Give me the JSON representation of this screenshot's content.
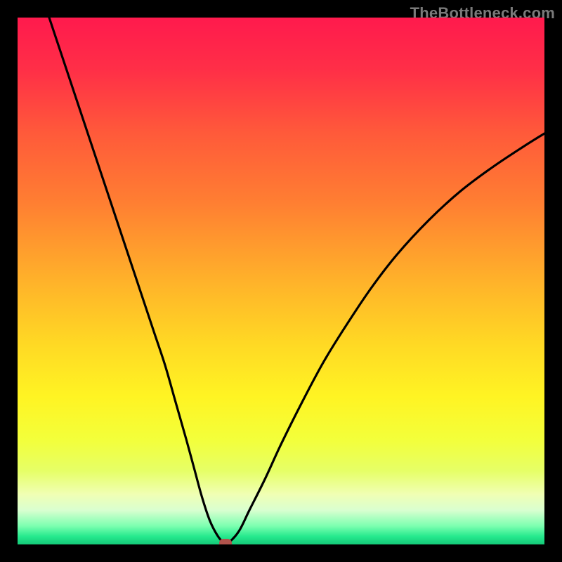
{
  "watermark": "TheBottleneck.com",
  "colors": {
    "frame": "#000000",
    "gradient_stops": [
      {
        "offset": 0.0,
        "color": "#ff1a4d"
      },
      {
        "offset": 0.1,
        "color": "#ff2f47"
      },
      {
        "offset": 0.22,
        "color": "#ff5a3a"
      },
      {
        "offset": 0.35,
        "color": "#ff7e32"
      },
      {
        "offset": 0.5,
        "color": "#ffb22a"
      },
      {
        "offset": 0.62,
        "color": "#ffd924"
      },
      {
        "offset": 0.72,
        "color": "#fff423"
      },
      {
        "offset": 0.8,
        "color": "#f3ff3a"
      },
      {
        "offset": 0.86,
        "color": "#e6ff66"
      },
      {
        "offset": 0.905,
        "color": "#f0ffb4"
      },
      {
        "offset": 0.935,
        "color": "#d9ffd0"
      },
      {
        "offset": 0.965,
        "color": "#7cffb0"
      },
      {
        "offset": 0.985,
        "color": "#25e98d"
      },
      {
        "offset": 1.0,
        "color": "#14c877"
      }
    ],
    "curve": "#000000",
    "marker": "#b1534c"
  },
  "chart_data": {
    "type": "line",
    "title": "",
    "xlabel": "",
    "ylabel": "",
    "xlim": [
      0,
      100
    ],
    "ylim": [
      0,
      100
    ],
    "grid": false,
    "series": [
      {
        "name": "bottleneck-curve",
        "x": [
          6,
          8,
          10,
          12,
          14,
          16,
          18,
          20,
          22,
          24,
          26,
          28,
          30,
          32,
          33.5,
          35,
          36.5,
          38,
          39.2,
          40,
          42,
          44,
          47,
          50,
          54,
          58,
          62,
          67,
          72,
          78,
          84,
          90,
          96,
          100
        ],
        "y": [
          100,
          94,
          88,
          82,
          76,
          70,
          64,
          58,
          52,
          46,
          40,
          34,
          27,
          20,
          14.5,
          9,
          4.5,
          1.6,
          0.3,
          0.3,
          2.5,
          6.5,
          12.5,
          19,
          27,
          34.5,
          41,
          48.5,
          55,
          61.5,
          67,
          71.5,
          75.5,
          78
        ]
      }
    ],
    "marker": {
      "x": 39.5,
      "y": 0.3,
      "label": "optimal-point"
    },
    "notes": "x and y are percentages of the inner plot area (0 = left/bottom, 100 = right/top); values estimated from pixel positions."
  }
}
